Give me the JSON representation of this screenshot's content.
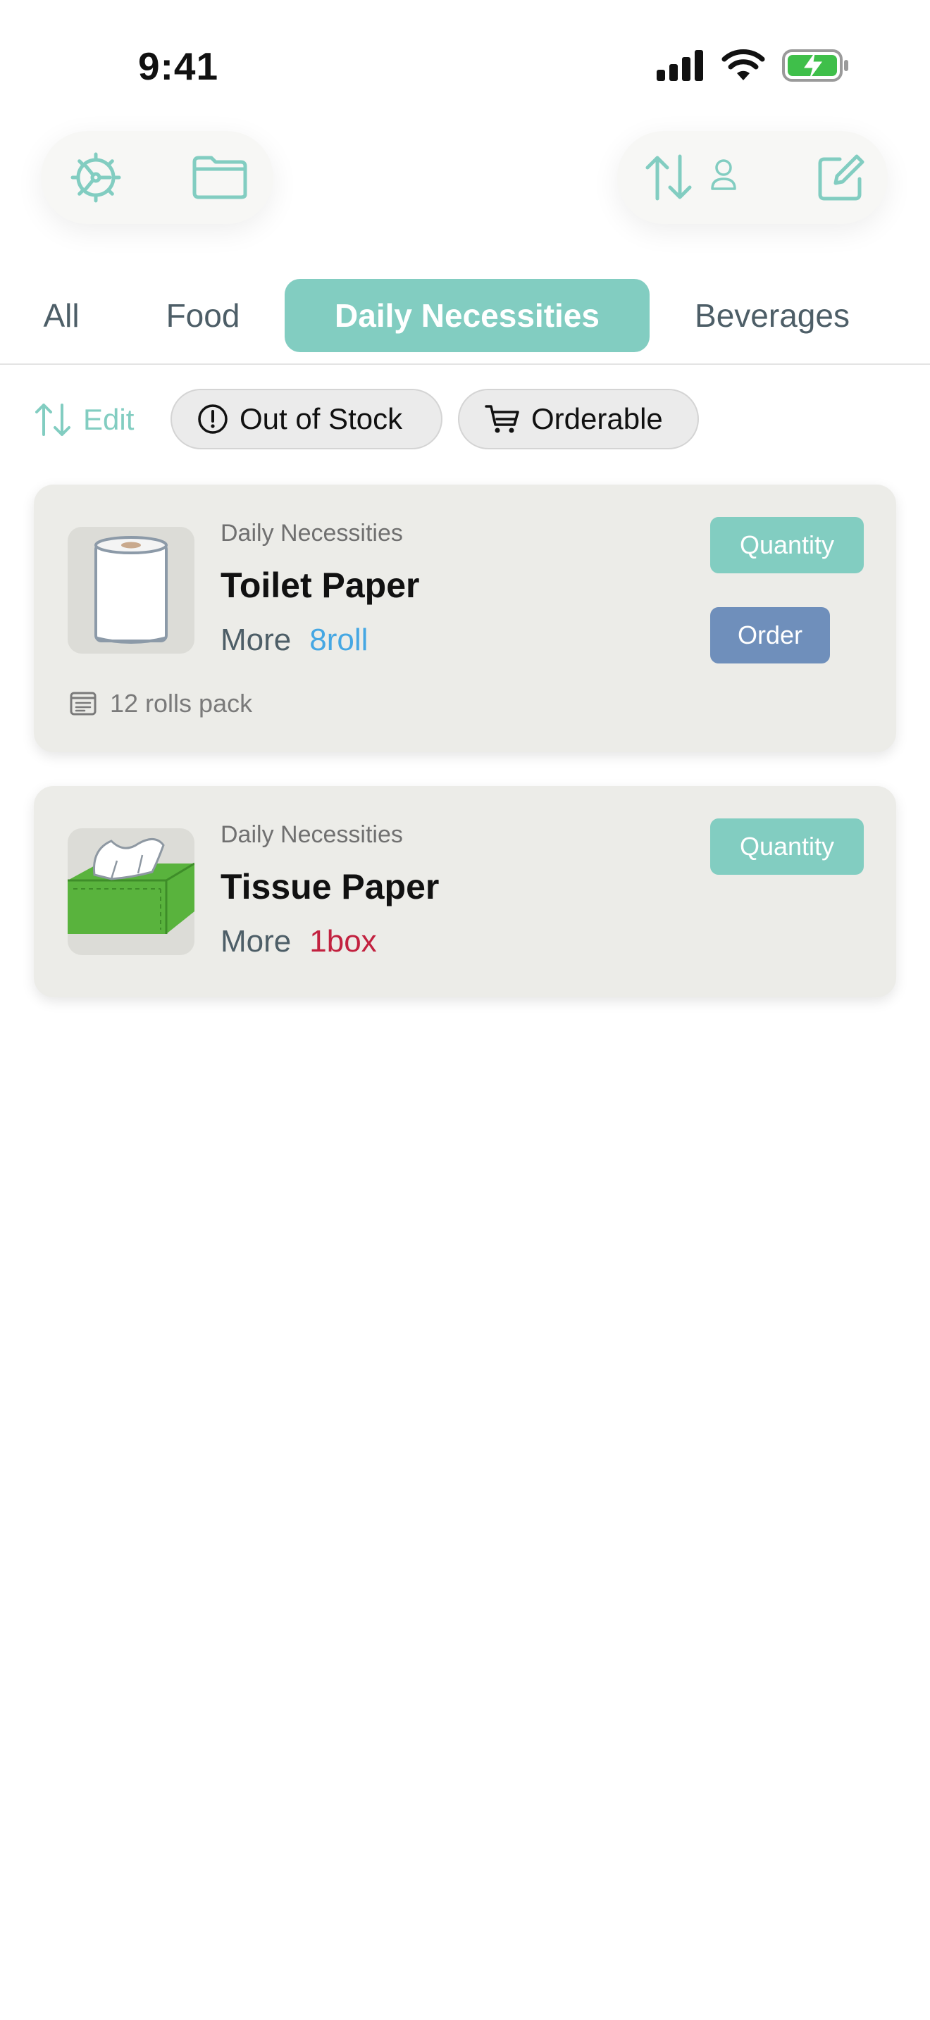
{
  "status_bar": {
    "time": "9:41"
  },
  "toolbar": {
    "left_icons": [
      "gear-icon",
      "folder-icon"
    ],
    "right_icons": [
      "sort-person-icon",
      "compose-icon"
    ],
    "accent": "#82cdc1"
  },
  "tabs": [
    {
      "label": "All",
      "active": false
    },
    {
      "label": "Food",
      "active": false
    },
    {
      "label": "Daily Necessities",
      "active": true
    },
    {
      "label": "Beverages",
      "active": false
    }
  ],
  "filters": {
    "edit_label": "Edit",
    "out_of_stock_label": "Out of Stock",
    "orderable_label": "Orderable"
  },
  "items": [
    {
      "category": "Daily Necessities",
      "name": "Toilet Paper",
      "more_label": "More",
      "amount": "8roll",
      "amount_color": "#45a7e3",
      "quantity_label": "Quantity",
      "order_label": "Order",
      "note": "12 rolls pack"
    },
    {
      "category": "Daily Necessities",
      "name": "Tissue Paper",
      "more_label": "More",
      "amount": "1box",
      "amount_color": "#c2213f",
      "quantity_label": "Quantity"
    }
  ]
}
